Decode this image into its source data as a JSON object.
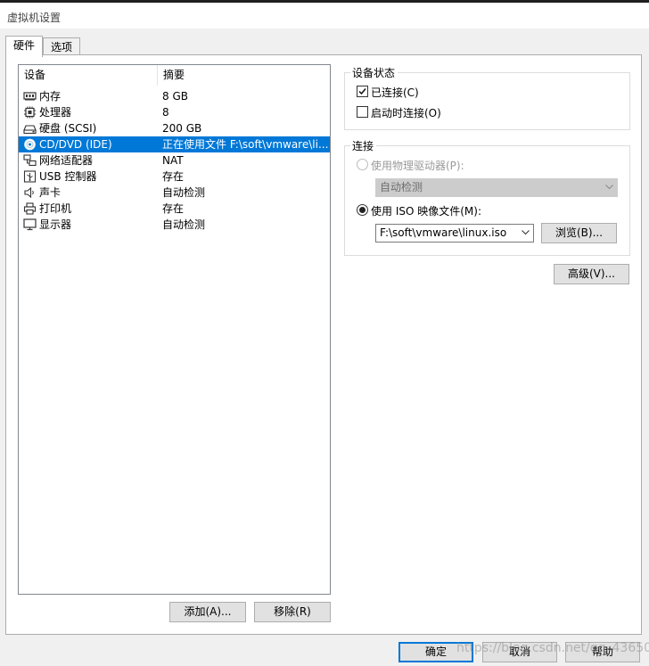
{
  "window": {
    "title": "虚拟机设置"
  },
  "tabs": [
    {
      "label": "硬件",
      "active": true
    },
    {
      "label": "选项",
      "active": false
    }
  ],
  "device_list": {
    "columns": [
      "设备",
      "摘要"
    ],
    "rows": [
      {
        "icon": "memory-icon",
        "name": "内存",
        "summary": "8 GB"
      },
      {
        "icon": "processor-icon",
        "name": "处理器",
        "summary": "8"
      },
      {
        "icon": "hard-disk-icon",
        "name": "硬盘 (SCSI)",
        "summary": "200 GB"
      },
      {
        "icon": "cd-dvd-icon",
        "name": "CD/DVD (IDE)",
        "summary": "正在使用文件 F:\\soft\\vmware\\li...",
        "selected": true
      },
      {
        "icon": "network-adapter-icon",
        "name": "网络适配器",
        "summary": "NAT"
      },
      {
        "icon": "usb-icon",
        "name": "USB 控制器",
        "summary": "存在"
      },
      {
        "icon": "sound-card-icon",
        "name": "声卡",
        "summary": "自动检测"
      },
      {
        "icon": "printer-icon",
        "name": "打印机",
        "summary": "存在"
      },
      {
        "icon": "display-icon",
        "name": "显示器",
        "summary": "自动检测"
      }
    ]
  },
  "list_buttons": {
    "add": "添加(A)...",
    "remove": "移除(R)"
  },
  "device_status": {
    "title": "设备状态",
    "connected_label": "已连接(C)",
    "connected": true,
    "connect_at_poweron_label": "启动时连接(O)",
    "connect_at_poweron": false
  },
  "connection": {
    "title": "连接",
    "physical_drive_label": "使用物理驱动器(P):",
    "physical_drive_value": "自动检测",
    "iso_label": "使用 ISO 映像文件(M):",
    "iso_path": "F:\\soft\\vmware\\linux.iso",
    "browse": "浏览(B)...",
    "selected": "iso"
  },
  "advanced": "高级(V)...",
  "footer": {
    "ok": "确定",
    "cancel": "取消",
    "help": "帮助"
  },
  "watermark": "https://blog.csdn.net/qq_43650",
  "colors": {
    "selection": "#0078d7",
    "background": "#f0f0f0"
  }
}
